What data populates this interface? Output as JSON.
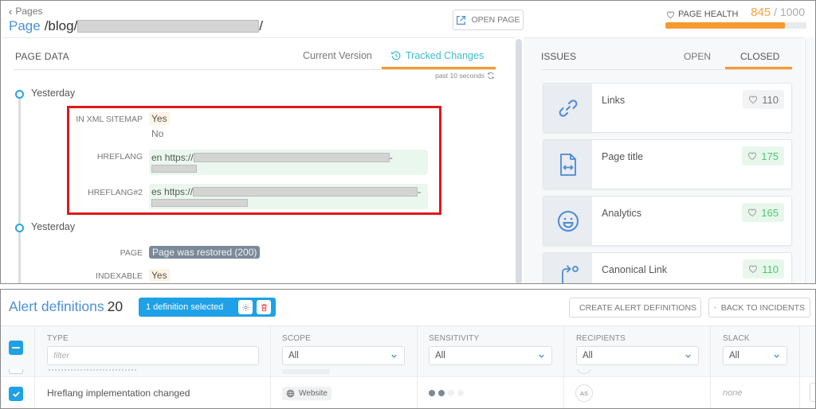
{
  "page_header": {
    "back_label": "Pages",
    "title_label": "Page",
    "path_prefix": "/blog/",
    "path_suffix": "/",
    "open_page_label": "OPEN PAGE",
    "health_label": "PAGE HEALTH",
    "health_score": "845",
    "health_max": "/ 1000",
    "health_fraction": 0.845,
    "colors": {
      "accent_blue": "#4a90d9",
      "health_orange": "#f79a2e",
      "tab_active": "#3dbbd6"
    }
  },
  "page_data": {
    "title": "PAGE DATA",
    "tabs": [
      {
        "label": "Current Version",
        "active": false
      },
      {
        "label": "Tracked Changes",
        "active": true,
        "icon": "history-icon"
      }
    ],
    "refresh_text": "past 10 seconds",
    "timeline": [
      {
        "label": "Yesterday",
        "changes": [
          {
            "field": "IN XML SITEMAP",
            "new_value": "Yes",
            "old_value": "No"
          },
          {
            "field": "HREFLANG",
            "lang": "en",
            "value_prefix": "https://",
            "redacted": true,
            "trailing": "-"
          },
          {
            "field": "HREFLANG#2",
            "lang": "es",
            "value_prefix": "https://",
            "redacted": true,
            "trailing": "-"
          }
        ]
      },
      {
        "label": "Yesterday",
        "changes": [
          {
            "field": "PAGE",
            "value": "Page was restored (200)"
          },
          {
            "field": "INDEXABLE",
            "value": "Yes"
          }
        ]
      }
    ]
  },
  "issues": {
    "title": "ISSUES",
    "tabs": [
      {
        "label": "OPEN",
        "active": false
      },
      {
        "label": "CLOSED",
        "active": true
      }
    ],
    "items": [
      {
        "name": "Links",
        "score": "110",
        "icon": "link-icon",
        "status": "neutral"
      },
      {
        "name": "Page title",
        "score": "175",
        "icon": "code-file-icon",
        "status": "good"
      },
      {
        "name": "Analytics",
        "score": "165",
        "icon": "smiley-icon",
        "status": "good"
      },
      {
        "name": "Canonical Link",
        "score": "110",
        "icon": "redirect-icon",
        "status": "good"
      }
    ]
  },
  "alerts": {
    "title": "Alert definitions",
    "count": "20",
    "selection_label": "1 definition selected",
    "create_label": "CREATE ALERT DEFINITIONS",
    "back_label": "BACK TO INCIDENTS",
    "columns": [
      {
        "label": "TYPE",
        "filter_placeholder": "filter"
      },
      {
        "label": "SCOPE",
        "selected": "All"
      },
      {
        "label": "SENSITIVITY",
        "selected": "All"
      },
      {
        "label": "RECIPIENTS",
        "selected": "All"
      },
      {
        "label": "SLACK",
        "selected": "All"
      }
    ],
    "rows": [
      {
        "checked": true,
        "type": "Hreflang implementation changed",
        "scope": "Website",
        "sensitivity_level": 2,
        "sensitivity_max": 4,
        "recipients": "AS",
        "slack": "none"
      }
    ]
  }
}
